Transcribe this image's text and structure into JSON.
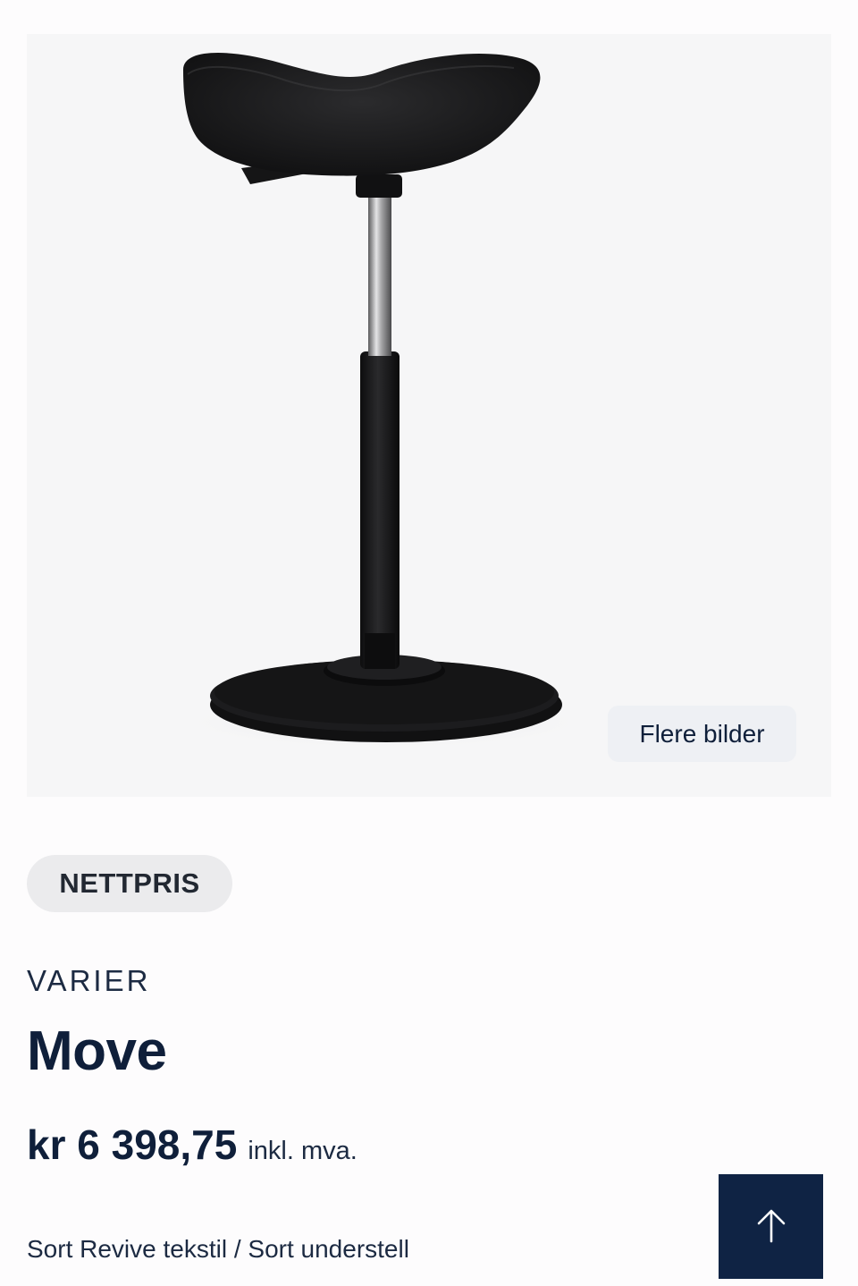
{
  "product": {
    "more_images_label": "Flere bilder",
    "badge": "NETTPRIS",
    "brand": "VARIER",
    "name": "Move",
    "price": "kr 6 398,75",
    "vat_note": "inkl. mva.",
    "variant": "Sort Revive tekstil / Sort understell",
    "image_icon": "saddle-stool-product-photo"
  },
  "scroll_top_icon": "arrow-up-icon",
  "colors": {
    "navy": "#0f2344",
    "text": "#0f1f3a",
    "badge_bg": "#ebebed",
    "chip_bg": "#eef0f4"
  }
}
